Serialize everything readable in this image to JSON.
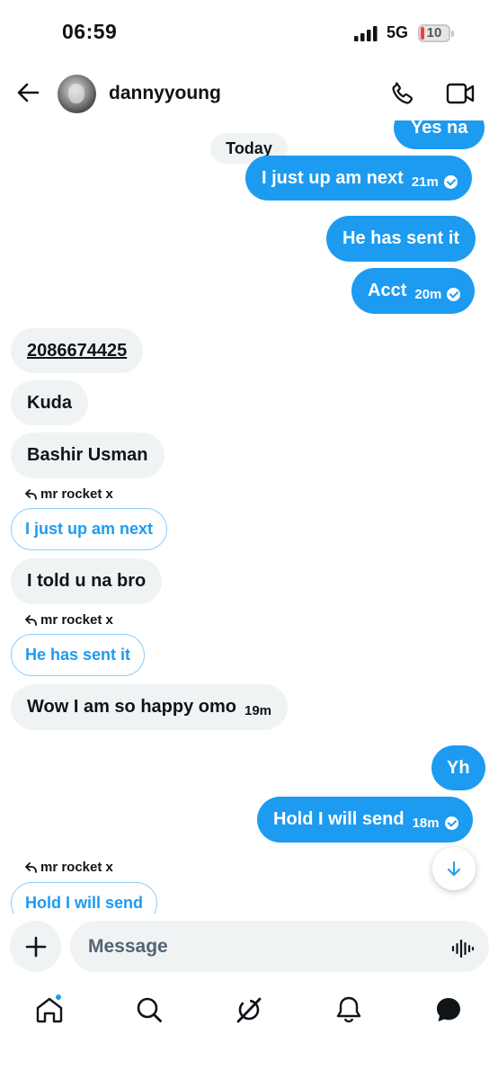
{
  "status_bar": {
    "time": "06:59",
    "network": "5G",
    "battery": "10"
  },
  "header": {
    "title": "dannyyoung"
  },
  "date_pill": "Today",
  "messages": [
    {
      "text": "Yes na"
    },
    {
      "text": "I just up am next",
      "time": "21m"
    },
    {
      "text": "He has sent it"
    },
    {
      "text": "Acct",
      "time": "20m"
    },
    {
      "text": "2086674425"
    },
    {
      "text": "Kuda"
    },
    {
      "text": "Bashir Usman"
    },
    {
      "reply_to": "mr rocket x",
      "quoted": "I just up am next"
    },
    {
      "text": "I told u na bro"
    },
    {
      "reply_to": "mr rocket x",
      "quoted": "He has sent it"
    },
    {
      "text": "Wow I am so happy omo",
      "time": "19m"
    },
    {
      "text": "Yh"
    },
    {
      "text": "Hold I will send",
      "time": "18m"
    },
    {
      "reply_to": "mr rocket x",
      "quoted": "Hold I will send"
    }
  ],
  "composer": {
    "placeholder": "Message"
  },
  "tabs": [
    "home-icon",
    "search-icon",
    "grok-icon",
    "notifications-icon",
    "messages-icon"
  ],
  "colors": {
    "accent": "#1d9bf0",
    "incoming": "#eff3f4",
    "text": "#0f1419"
  }
}
